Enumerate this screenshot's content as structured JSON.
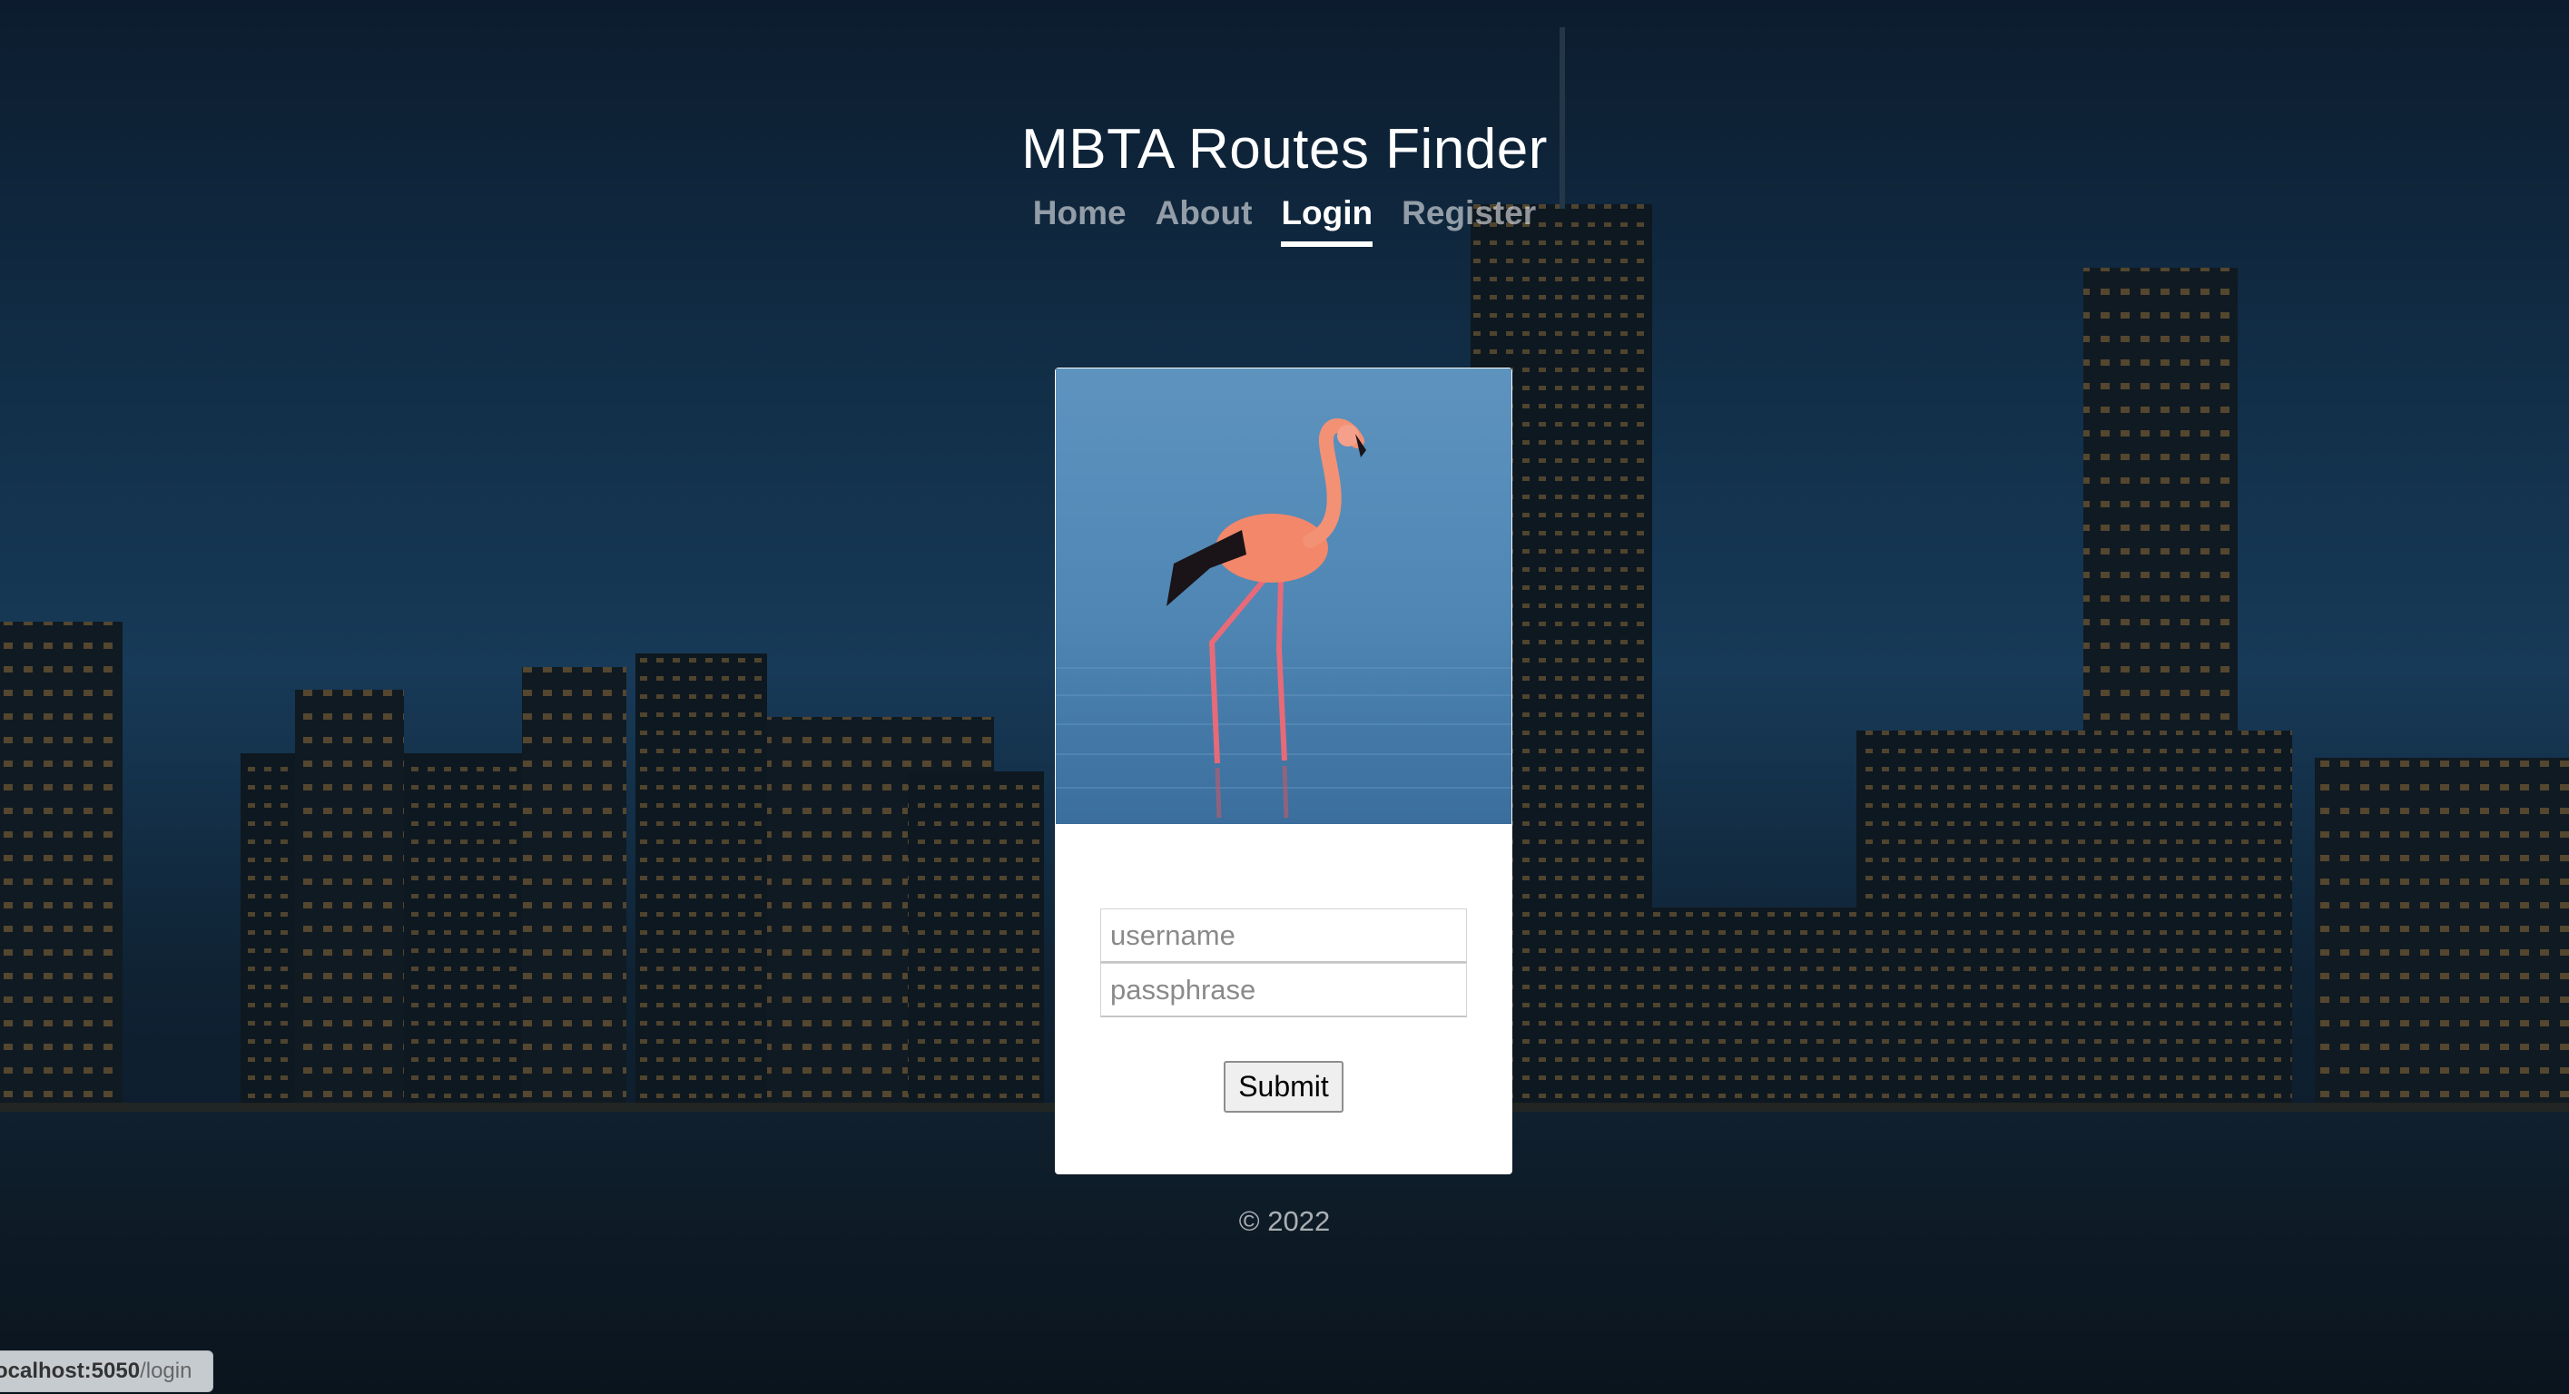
{
  "site": {
    "title": "MBTA Routes Finder"
  },
  "nav": {
    "items": [
      {
        "label": "Home",
        "active": false
      },
      {
        "label": "About",
        "active": false
      },
      {
        "label": "Login",
        "active": true
      },
      {
        "label": "Register",
        "active": false
      }
    ]
  },
  "login_form": {
    "username_placeholder": "username",
    "password_placeholder": "passphrase",
    "submit_label": "Submit"
  },
  "footer": {
    "text": "© 2022"
  },
  "status_bar": {
    "host": "ocalhost:5050",
    "path": "/login"
  },
  "colors": {
    "sky_top": "#0c1c2e",
    "water": "#0a1622",
    "card_bg": "#ffffff",
    "photo_sky": "#5b8fb8",
    "flamingo": "#f08a6a"
  }
}
